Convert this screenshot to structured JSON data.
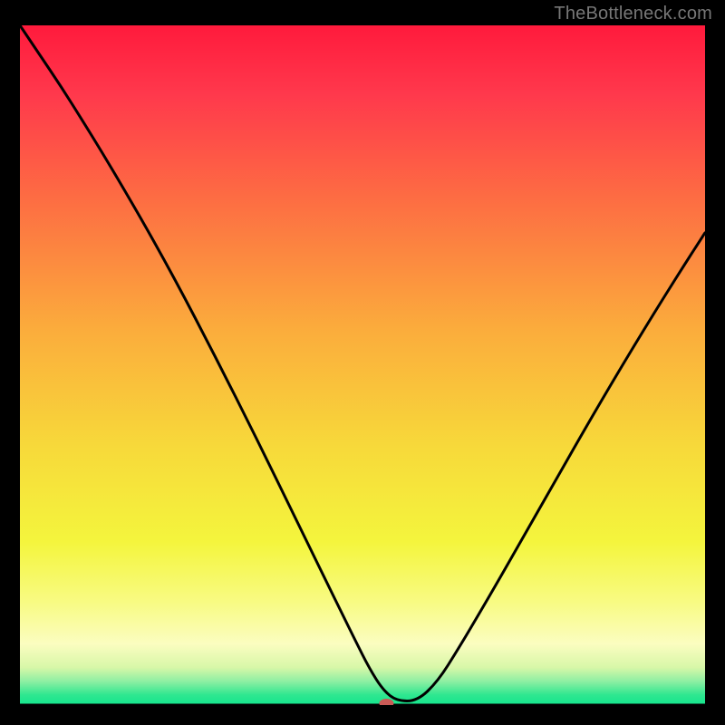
{
  "watermark": "TheBottleneck.com",
  "chart_data": {
    "type": "line",
    "title": "",
    "xlabel": "",
    "ylabel": "",
    "xlim": [
      0,
      100
    ],
    "ylim": [
      0,
      100
    ],
    "grid": false,
    "legend": false,
    "background_gradient": {
      "stops": [
        {
          "offset": 0.0,
          "color": "#ff1a3c"
        },
        {
          "offset": 0.1,
          "color": "#ff384c"
        },
        {
          "offset": 0.25,
          "color": "#fd6b43"
        },
        {
          "offset": 0.45,
          "color": "#fbad3c"
        },
        {
          "offset": 0.62,
          "color": "#f7d93a"
        },
        {
          "offset": 0.76,
          "color": "#f4f53d"
        },
        {
          "offset": 0.85,
          "color": "#f8fb84"
        },
        {
          "offset": 0.91,
          "color": "#fbfdc0"
        },
        {
          "offset": 0.945,
          "color": "#d7f7a8"
        },
        {
          "offset": 0.965,
          "color": "#8eefa3"
        },
        {
          "offset": 0.985,
          "color": "#2fe790"
        },
        {
          "offset": 1.0,
          "color": "#14e58d"
        }
      ]
    },
    "series": [
      {
        "name": "bottleneck-curve",
        "x": [
          0,
          3,
          6,
          9,
          12,
          15,
          18,
          21,
          24,
          27,
          30,
          33,
          36,
          39,
          42,
          45,
          47,
          49,
          51,
          53,
          55,
          58,
          61,
          64,
          67,
          70,
          73,
          76,
          79,
          82,
          85,
          88,
          91,
          94,
          97,
          100
        ],
        "y": [
          100,
          95.5,
          91,
          86.2,
          81.3,
          76.2,
          71,
          65.6,
          60,
          54.2,
          48.3,
          42.3,
          36.2,
          30,
          23.8,
          17.6,
          13.5,
          9.4,
          5.4,
          2.2,
          0.6,
          0.6,
          3.5,
          8.3,
          13.4,
          18.6,
          23.9,
          29.2,
          34.5,
          39.8,
          45.0,
          50.1,
          55.1,
          60.0,
          64.8,
          69.5
        ]
      }
    ],
    "marker": {
      "name": "baseline-marker",
      "x": 53.5,
      "y": 0,
      "color": "#c95a56",
      "rx": 8,
      "ry": 5
    }
  }
}
